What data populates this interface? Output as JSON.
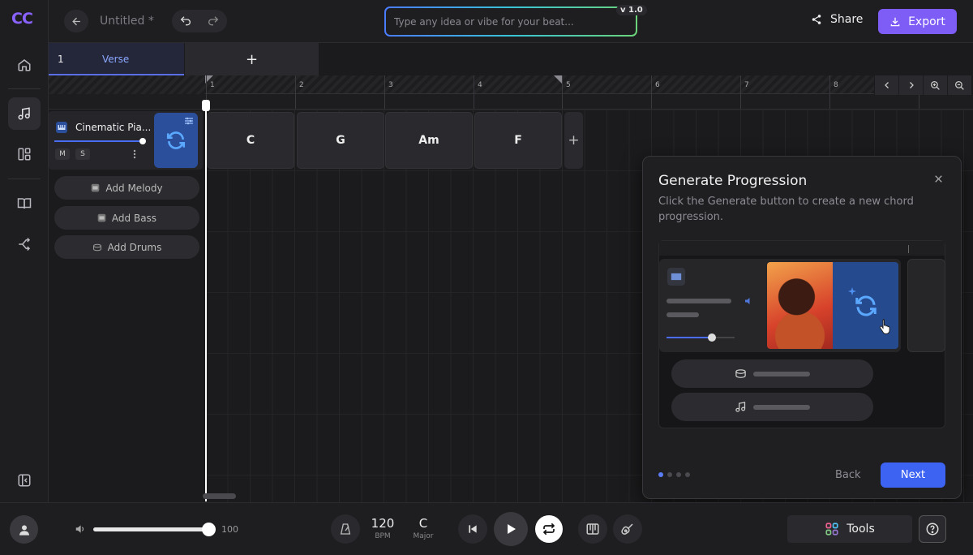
{
  "app": {
    "logo": "CC"
  },
  "topbar": {
    "title": "Untitled *",
    "prompt_placeholder": "Type any idea or vibe for your beat...",
    "version": "v 1.0",
    "share_label": "Share",
    "export_label": "Export"
  },
  "sidebar": {
    "items": [
      {
        "icon": "home-icon"
      },
      {
        "icon": "music-note-icon",
        "active": true
      },
      {
        "icon": "layout-icon"
      },
      {
        "icon": "book-icon"
      },
      {
        "icon": "share-flow-icon"
      },
      {
        "icon": "collapse-icon"
      }
    ]
  },
  "sections": [
    {
      "number": "1",
      "label": "Verse"
    }
  ],
  "section_add_label": "+",
  "ruler": {
    "bars": [
      "1",
      "2",
      "3",
      "4",
      "5",
      "6",
      "7",
      "8"
    ]
  },
  "track": {
    "name": "Cinematic Pia...",
    "mute_label": "M",
    "solo_label": "S"
  },
  "add_buttons": [
    {
      "label": "Add Melody"
    },
    {
      "label": "Add Bass"
    },
    {
      "label": "Add Drums"
    }
  ],
  "chords": [
    "C",
    "G",
    "Am",
    "F"
  ],
  "chord_add_label": "+",
  "popup": {
    "title": "Generate Progression",
    "description": "Click the Generate button to create a new chord progression.",
    "back_label": "Back",
    "next_label": "Next",
    "step_current": 1,
    "step_total": 4
  },
  "transport": {
    "volume": "100",
    "volume_fraction": 0.93,
    "tempo": "120",
    "tempo_label": "BPM",
    "key": "C",
    "key_label": "Major",
    "tools_label": "Tools"
  },
  "colors": {
    "accent": "#7e5cf6",
    "next_blue": "#3d63f2",
    "generate_tile": "#2c4f9c"
  }
}
